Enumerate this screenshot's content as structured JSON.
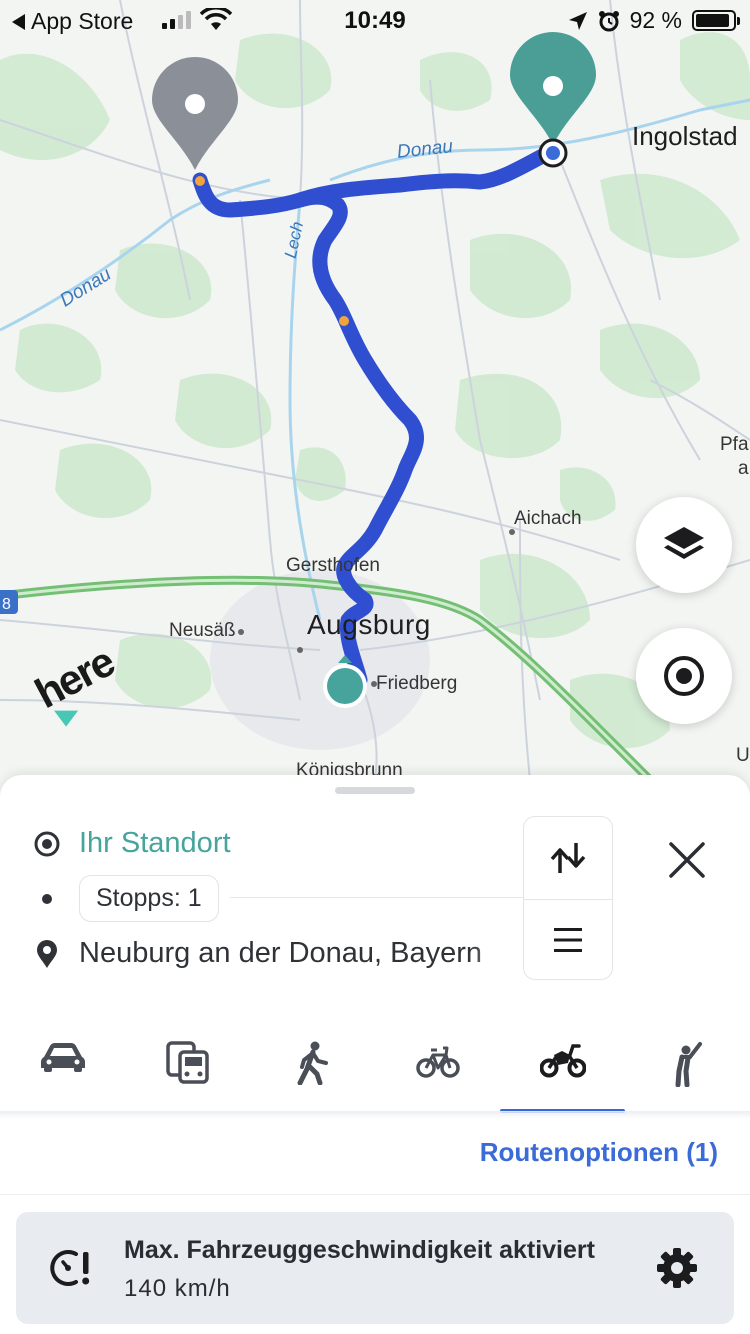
{
  "status_bar": {
    "back_label": "App Store",
    "time": "10:49",
    "battery": "92 %",
    "battery_level": 0.92
  },
  "map": {
    "labels": {
      "ingolstadt": "Ingolstad",
      "donau_north": "Donau",
      "donau_west": "Donau",
      "lech": "Lech",
      "aichach": "Aichach",
      "gersthofen": "Gersthofen",
      "augsburg": "Augsburg",
      "neusaess": "Neusäß",
      "friedberg": "Friedberg",
      "koenigsbrunn": "Königsbrunn",
      "pfa": "Pfa",
      "a_edge": "a",
      "u_edge": "U",
      "road_shield": "8"
    },
    "brand_logo": "here",
    "accent_color": "#4a9e96",
    "route_color": "#2f4fd0"
  },
  "route_panel": {
    "origin": "Ihr Standort",
    "stops": "Stopps: 1",
    "destination": "Neuburg an der Donau, Bayern",
    "route_options": "Routenoptionen (1)"
  },
  "transport_modes": [
    {
      "name": "car",
      "icon": "car-icon",
      "selected": false
    },
    {
      "name": "transit",
      "icon": "transit-icon",
      "selected": false
    },
    {
      "name": "walk",
      "icon": "walk-icon",
      "selected": false
    },
    {
      "name": "bicycle",
      "icon": "bicycle-icon",
      "selected": false
    },
    {
      "name": "motorcycle",
      "icon": "motorcycle-icon",
      "selected": true
    },
    {
      "name": "taxi",
      "icon": "hail-icon",
      "selected": false
    }
  ],
  "speed_card": {
    "title": "Max. Fahrzeuggeschwindigkeit aktiviert",
    "value": "140 km/h"
  },
  "colors": {
    "accent_teal": "#46a49c",
    "link_blue": "#3a6bd6",
    "grey_pin": "#8b9098",
    "orange_stop": "#f2a33a"
  }
}
